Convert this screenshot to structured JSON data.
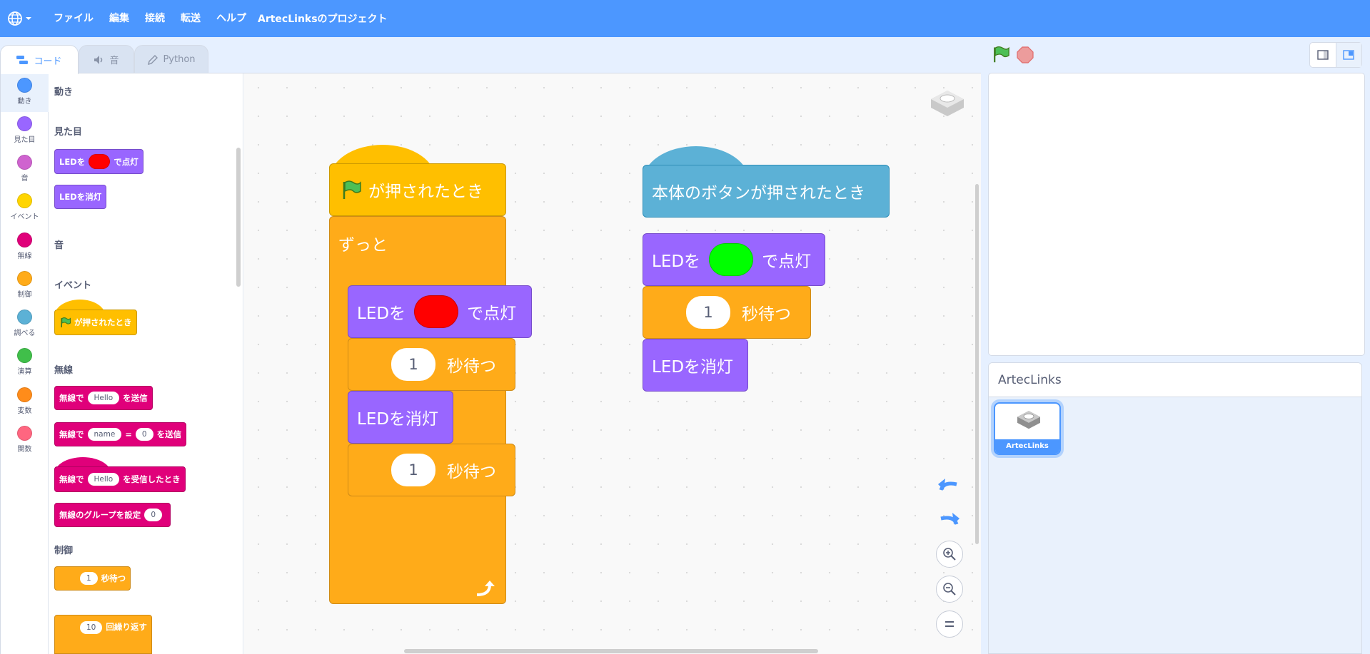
{
  "menubar": {
    "items": [
      "ファイル",
      "編集",
      "接続",
      "転送",
      "ヘルプ"
    ],
    "project_title": "ArtecLinksのプロジェクト"
  },
  "tabs": [
    {
      "label": "コード",
      "icon": "code-icon",
      "active": true
    },
    {
      "label": "音",
      "icon": "speaker-icon",
      "active": false
    },
    {
      "label": "Python",
      "icon": "pencil-icon",
      "active": false
    }
  ],
  "categories": [
    {
      "label": "動き",
      "color": "#4c97ff"
    },
    {
      "label": "見た目",
      "color": "#9966ff"
    },
    {
      "label": "音",
      "color": "#cf63cf"
    },
    {
      "label": "イベント",
      "color": "#ffd500"
    },
    {
      "label": "無線",
      "color": "#e0007a"
    },
    {
      "label": "制御",
      "color": "#ffab19"
    },
    {
      "label": "調べる",
      "color": "#5cb1d6"
    },
    {
      "label": "演算",
      "color": "#40bf4a"
    },
    {
      "label": "変数",
      "color": "#ff8c1a"
    },
    {
      "label": "関数",
      "color": "#ff6680"
    }
  ],
  "palette": {
    "sections": {
      "motion": "動き",
      "looks": "見た目",
      "sound": "音",
      "events": "イベント",
      "radio": "無線",
      "control": "制御"
    },
    "led_on": {
      "prefix": "LEDを",
      "color": "#ff0000",
      "suffix": "で点灯"
    },
    "led_off": "LEDを消灯",
    "flag_hat": "が押されたとき",
    "radio_send": {
      "prefix": "無線で",
      "value": "Hello",
      "suffix": "を送信"
    },
    "radio_send_pair": {
      "prefix": "無線で",
      "name": "name",
      "eq": "=",
      "value": "0",
      "suffix": "を送信"
    },
    "radio_receive": {
      "prefix": "無線で",
      "value": "Hello",
      "suffix": "を受信したとき"
    },
    "radio_group": {
      "label": "無線のグループを設定",
      "value": "0"
    },
    "wait": {
      "value": "1",
      "label": "秒待つ"
    },
    "repeat": {
      "value": "10",
      "label": "回繰り返す"
    }
  },
  "script1": {
    "hat": "が押されたとき",
    "forever": "ずっと",
    "led_on": {
      "prefix": "LEDを",
      "color": "#ff0000",
      "suffix": "で点灯"
    },
    "wait1": {
      "value": "1",
      "label": "秒待つ"
    },
    "led_off": "LEDを消灯",
    "wait2": {
      "value": "1",
      "label": "秒待つ"
    }
  },
  "script2": {
    "hat": "本体のボタンが押されたとき",
    "led_on": {
      "prefix": "LEDを",
      "color": "#00ff00",
      "suffix": "で点灯"
    },
    "wait": {
      "value": "1",
      "label": "秒待つ"
    },
    "led_off": "LEDを消灯"
  },
  "sprite_pane": {
    "header": "ArtecLinks",
    "sprites": [
      {
        "name": "ArtecLinks",
        "selected": true
      }
    ]
  },
  "colors": {
    "menubar": "#4c97ff",
    "looks": "#9966ff",
    "events": "#ffbf00",
    "control": "#ffab19",
    "radio": "#e0007a",
    "sensing": "#5cb1d6"
  }
}
